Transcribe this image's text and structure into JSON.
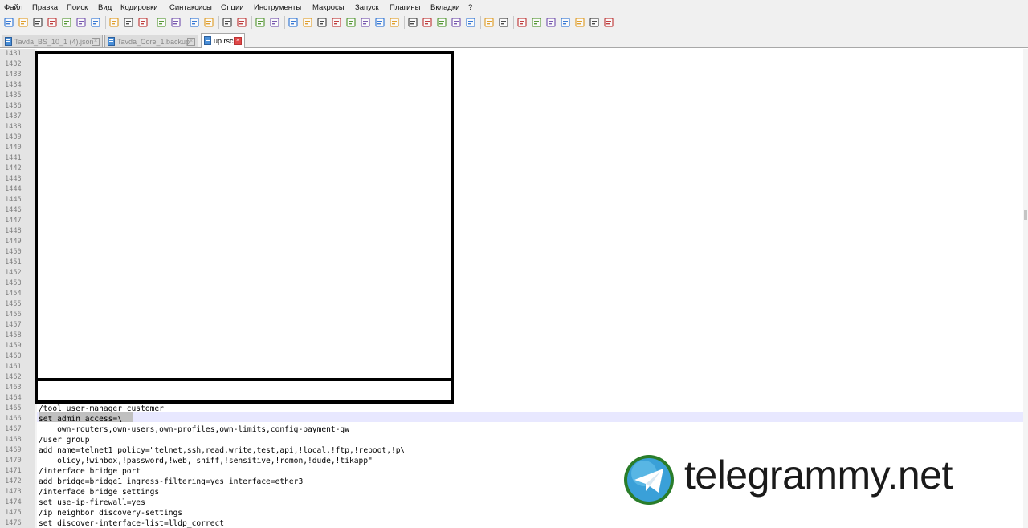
{
  "menu": [
    "Файл",
    "Правка",
    "Поиск",
    "Вид",
    "Кодировки",
    "Синтаксисы",
    "Опции",
    "Инструменты",
    "Макросы",
    "Запуск",
    "Плагины",
    "Вкладки",
    "?"
  ],
  "toolbar_icons": [
    "new-file-icon",
    "open-file-icon",
    "save-icon",
    "save-all-icon",
    "close-icon",
    "close-all-icon",
    "print-icon",
    "cut-icon",
    "copy-icon",
    "paste-icon",
    "undo-icon",
    "redo-icon",
    "find-icon",
    "replace-icon",
    "zoom-in-icon",
    "zoom-out-icon",
    "sync-vertical-icon",
    "sync-horizontal-icon",
    "word-wrap-icon",
    "show-all-chars-icon",
    "indent-guide-icon",
    "user-language-icon",
    "doc-map-icon",
    "function-list-icon",
    "folder-workspace-icon",
    "monitoring-icon",
    "record-macro-icon",
    "stop-macro-icon",
    "play-macro-icon",
    "run-macro-multiple-icon",
    "save-macro-icon",
    "plugin-icon",
    "doc-switcher-icon",
    "compare-icon",
    "next-diff-icon",
    "prev-diff-icon",
    "up-arrow-icon",
    "down-arrow-icon",
    "last-diff-icon",
    "panel-icon"
  ],
  "tabs": [
    {
      "label": "Tavda_BS_10_1 (4).json",
      "active": false
    },
    {
      "label": "Tavda_Core_1.backup",
      "active": false
    },
    {
      "label": "up.rsc",
      "active": true
    }
  ],
  "editor": {
    "first_line": 1431,
    "last_line": 1476,
    "visible_code": [
      {
        "line": 1465,
        "text": "/tool user-manager customer"
      },
      {
        "line": 1466,
        "text": "set admin access=\\"
      },
      {
        "line": 1467,
        "text": "    own-routers,own-users,own-profiles,own-limits,config-payment-gw"
      },
      {
        "line": 1468,
        "text": "/user group"
      },
      {
        "line": 1469,
        "text": "add name=telnet1 policy=\"telnet,ssh,read,write,test,api,!local,!ftp,!reboot,!p\\"
      },
      {
        "line": 1470,
        "text": "    olicy,!winbox,!password,!web,!sniff,!sensitive,!romon,!dude,!tikapp\""
      },
      {
        "line": 1471,
        "text": "/interface bridge port"
      },
      {
        "line": 1472,
        "text": "add bridge=bridge1 ingress-filtering=yes interface=ether3"
      },
      {
        "line": 1473,
        "text": "/interface bridge settings"
      },
      {
        "line": 1474,
        "text": "set use-ip-firewall=yes"
      },
      {
        "line": 1475,
        "text": "/ip neighbor discovery-settings"
      },
      {
        "line": 1476,
        "text": "set discover-interface-list=lldp_correct"
      }
    ]
  },
  "watermark": {
    "text": "telegrammy.net",
    "color": "#1a1a1a",
    "accent": "#3aa0d8"
  },
  "colors": {
    "gutter": "#e4e4e4",
    "current_line": "#e8e8ff",
    "selection": "#c0c0c0",
    "tab_close_active": "#e04848"
  }
}
